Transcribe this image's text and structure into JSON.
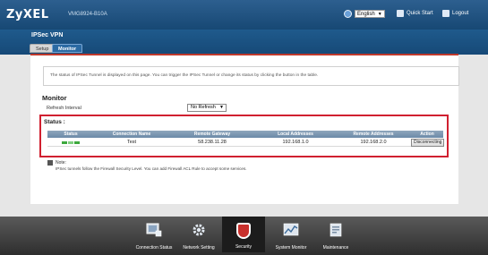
{
  "header": {
    "logo": "ZyXEL",
    "model": "VMG8924-B10A",
    "language": "English",
    "quick_start": "Quick Start",
    "logout": "Logout"
  },
  "page": {
    "title": "IPSec VPN",
    "tabs": [
      {
        "label": "Setup",
        "active": false
      },
      {
        "label": "Monitor",
        "active": true
      }
    ]
  },
  "notice": "The status of IPSec Tunnel is displayed on this page. You can trigger the IPSec Tunnel or change its status by clicking the button in the table.",
  "monitor": {
    "heading": "Monitor",
    "refresh_label": "Refresh Interval",
    "refresh_value": "No Refresh"
  },
  "status": {
    "label": "Status :",
    "columns": [
      "Status",
      "Connection Name",
      "Remote Gateway",
      "Local Addresses",
      "Remote Addresses",
      "Action"
    ],
    "rows": [
      {
        "connection_name": "Test",
        "remote_gateway": "58.238.11.28",
        "local_addresses": "192.168.1.0",
        "remote_addresses": "192.168.2.0",
        "action": "Disconnecting"
      }
    ]
  },
  "note": {
    "label": "Note:",
    "text": "IPSec tunnels follow the Firewall Security Level. You can add Firewall ACL Rule to accept some services."
  },
  "bottom_nav": [
    {
      "label": "Connection Status",
      "icon": "connection-status-icon"
    },
    {
      "label": "Network Setting",
      "icon": "gear-icon"
    },
    {
      "label": "Security",
      "icon": "shield-icon",
      "active": true
    },
    {
      "label": "System Monitor",
      "icon": "chart-icon"
    },
    {
      "label": "Maintenance",
      "icon": "maintenance-icon"
    }
  ],
  "colors": {
    "header_blue": "#1f5a8c",
    "highlight_red": "#d02030",
    "status_green": "#3da83d",
    "security_red": "#c9302c"
  }
}
